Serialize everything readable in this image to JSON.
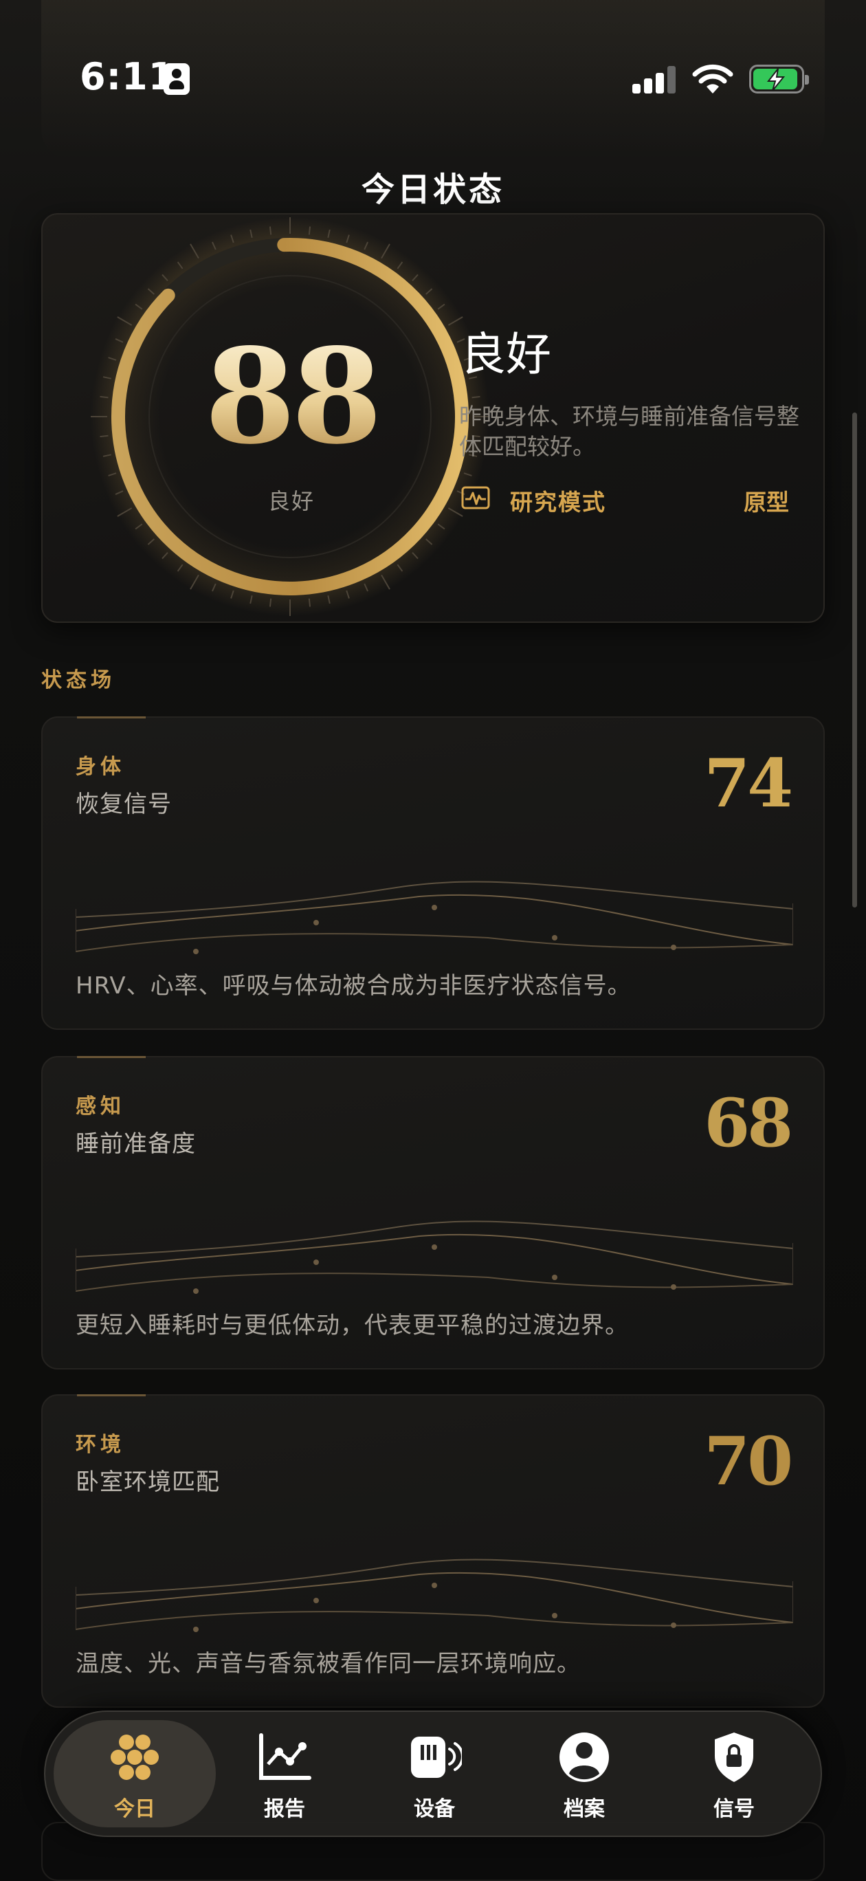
{
  "status_bar": {
    "time": "6:11"
  },
  "header": {
    "title": "今日状态"
  },
  "hero": {
    "score": "88",
    "score_caption": "良好",
    "state_label": "良好",
    "description": "昨晚身体、环境与睡前准备信号整体匹配较好。",
    "mode_label": "研究模式",
    "badge": "原型",
    "score_fraction": 0.88,
    "ring_color": "#d6a954"
  },
  "fields": {
    "section_title": "状态场",
    "items": [
      {
        "kicker": "身体",
        "title": "恢复信号",
        "score": "74",
        "description": "HRV、心率、呼吸与体动被合成为非医疗状态信号。"
      },
      {
        "kicker": "感知",
        "title": "睡前准备度",
        "score": "68",
        "description": "更短入睡耗时与更低体动，代表更平稳的过渡边界。"
      },
      {
        "kicker": "环境",
        "title": "卧室环境匹配",
        "score": "70",
        "description": "温度、光、声音与香氛被看作同一层环境响应。"
      }
    ]
  },
  "tabbar": {
    "active": "今日",
    "items": [
      {
        "label": "今日",
        "icon": "flower-dots-icon"
      },
      {
        "label": "报告",
        "icon": "chart-line-icon"
      },
      {
        "label": "设备",
        "icon": "device-speaker-icon"
      },
      {
        "label": "档案",
        "icon": "profile-person-icon"
      },
      {
        "label": "信号",
        "icon": "shield-lock-icon"
      }
    ]
  },
  "colors": {
    "accent": "#d7a64f",
    "background": "#0e0e0d",
    "card": "#161514"
  }
}
